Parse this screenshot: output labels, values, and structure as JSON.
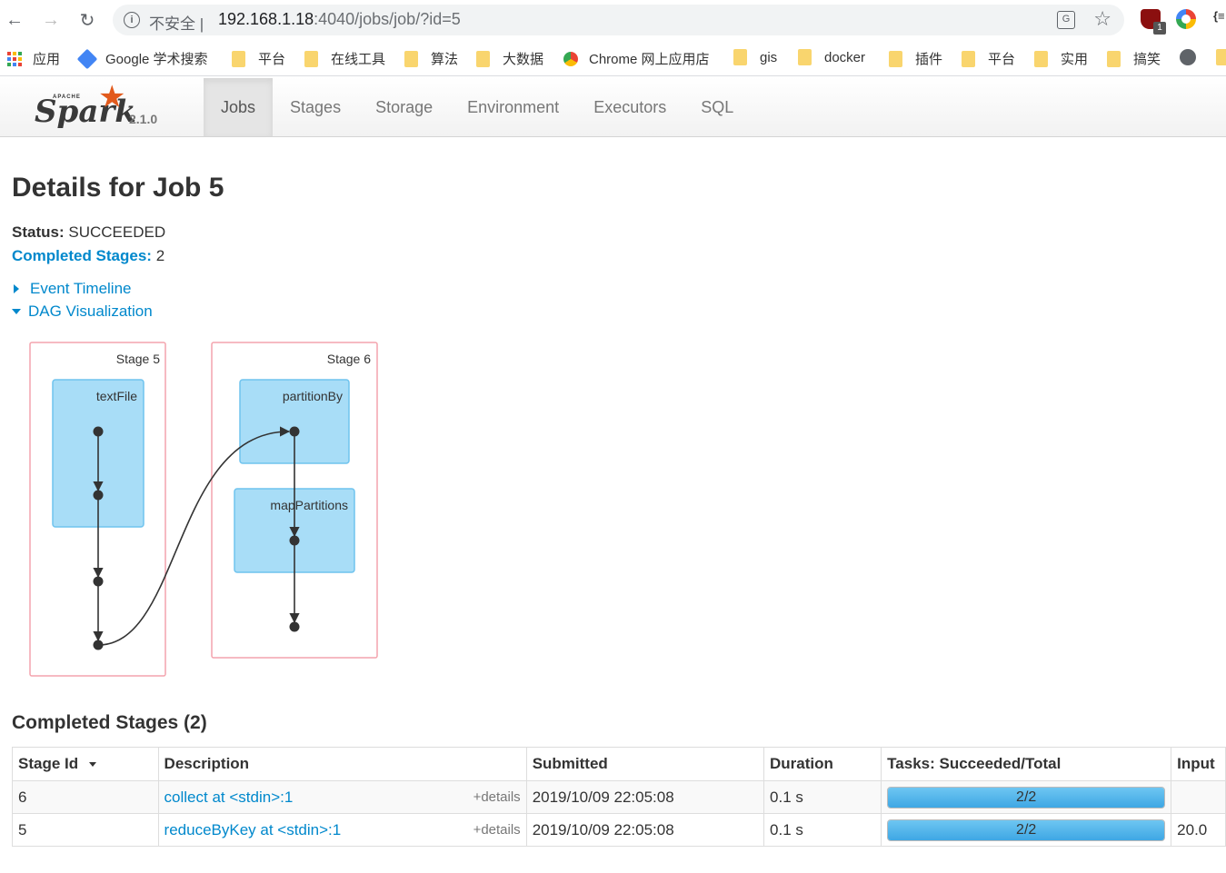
{
  "browser": {
    "insecure_label": "不安全 |",
    "url_host": "192.168.1.18",
    "url_rest": ":4040/jobs/job/?id=5",
    "translate_icon": "translate-icon",
    "extension_badge": "1",
    "extension_json_label": "{≡"
  },
  "bookmarks": [
    {
      "label": "应用",
      "icon": "apps-icon"
    },
    {
      "label": "Google 学术搜索",
      "icon": "google-scholar-icon"
    },
    {
      "label": "平台",
      "icon": "folder-icon"
    },
    {
      "label": "在线工具",
      "icon": "folder-icon"
    },
    {
      "label": "算法",
      "icon": "folder-icon"
    },
    {
      "label": "大数据",
      "icon": "folder-icon"
    },
    {
      "label": "Chrome 网上应用店",
      "icon": "chrome-webstore-icon"
    },
    {
      "label": "gis",
      "icon": "folder-icon"
    },
    {
      "label": "docker",
      "icon": "folder-icon"
    },
    {
      "label": "插件",
      "icon": "folder-icon"
    },
    {
      "label": "平台",
      "icon": "folder-icon"
    },
    {
      "label": "实用",
      "icon": "folder-icon"
    },
    {
      "label": "搞笑",
      "icon": "folder-icon"
    }
  ],
  "spark": {
    "logo_apache": "APACHE",
    "logo_word": "Spark",
    "version": "2.1.0",
    "tabs": [
      "Jobs",
      "Stages",
      "Storage",
      "Environment",
      "Executors",
      "SQL"
    ],
    "active_tab": "Jobs"
  },
  "job": {
    "title": "Details for Job 5",
    "status_label": "Status:",
    "status_value": "SUCCEEDED",
    "completed_label": "Completed Stages:",
    "completed_value": "2",
    "event_timeline": "Event Timeline",
    "dag_visualization": "DAG Visualization"
  },
  "dag": {
    "stages": [
      {
        "label": "Stage 5",
        "ops": [
          "textFile"
        ]
      },
      {
        "label": "Stage 6",
        "ops": [
          "partitionBy",
          "mapPartitions"
        ]
      }
    ]
  },
  "completed_stages": {
    "title": "Completed Stages (2)",
    "columns": [
      "Stage Id",
      "Description",
      "Submitted",
      "Duration",
      "Tasks: Succeeded/Total",
      "Input"
    ],
    "details_label": "+details",
    "rows": [
      {
        "stage_id": "6",
        "description": "collect at <stdin>:1",
        "submitted": "2019/10/09 22:05:08",
        "duration": "0.1 s",
        "tasks": "2/2",
        "tasks_fraction": 1.0,
        "input": ""
      },
      {
        "stage_id": "5",
        "description": "reduceByKey at <stdin>:1",
        "submitted": "2019/10/09 22:05:08",
        "duration": "0.1 s",
        "tasks": "2/2",
        "tasks_fraction": 1.0,
        "input": "20.0"
      }
    ]
  }
}
